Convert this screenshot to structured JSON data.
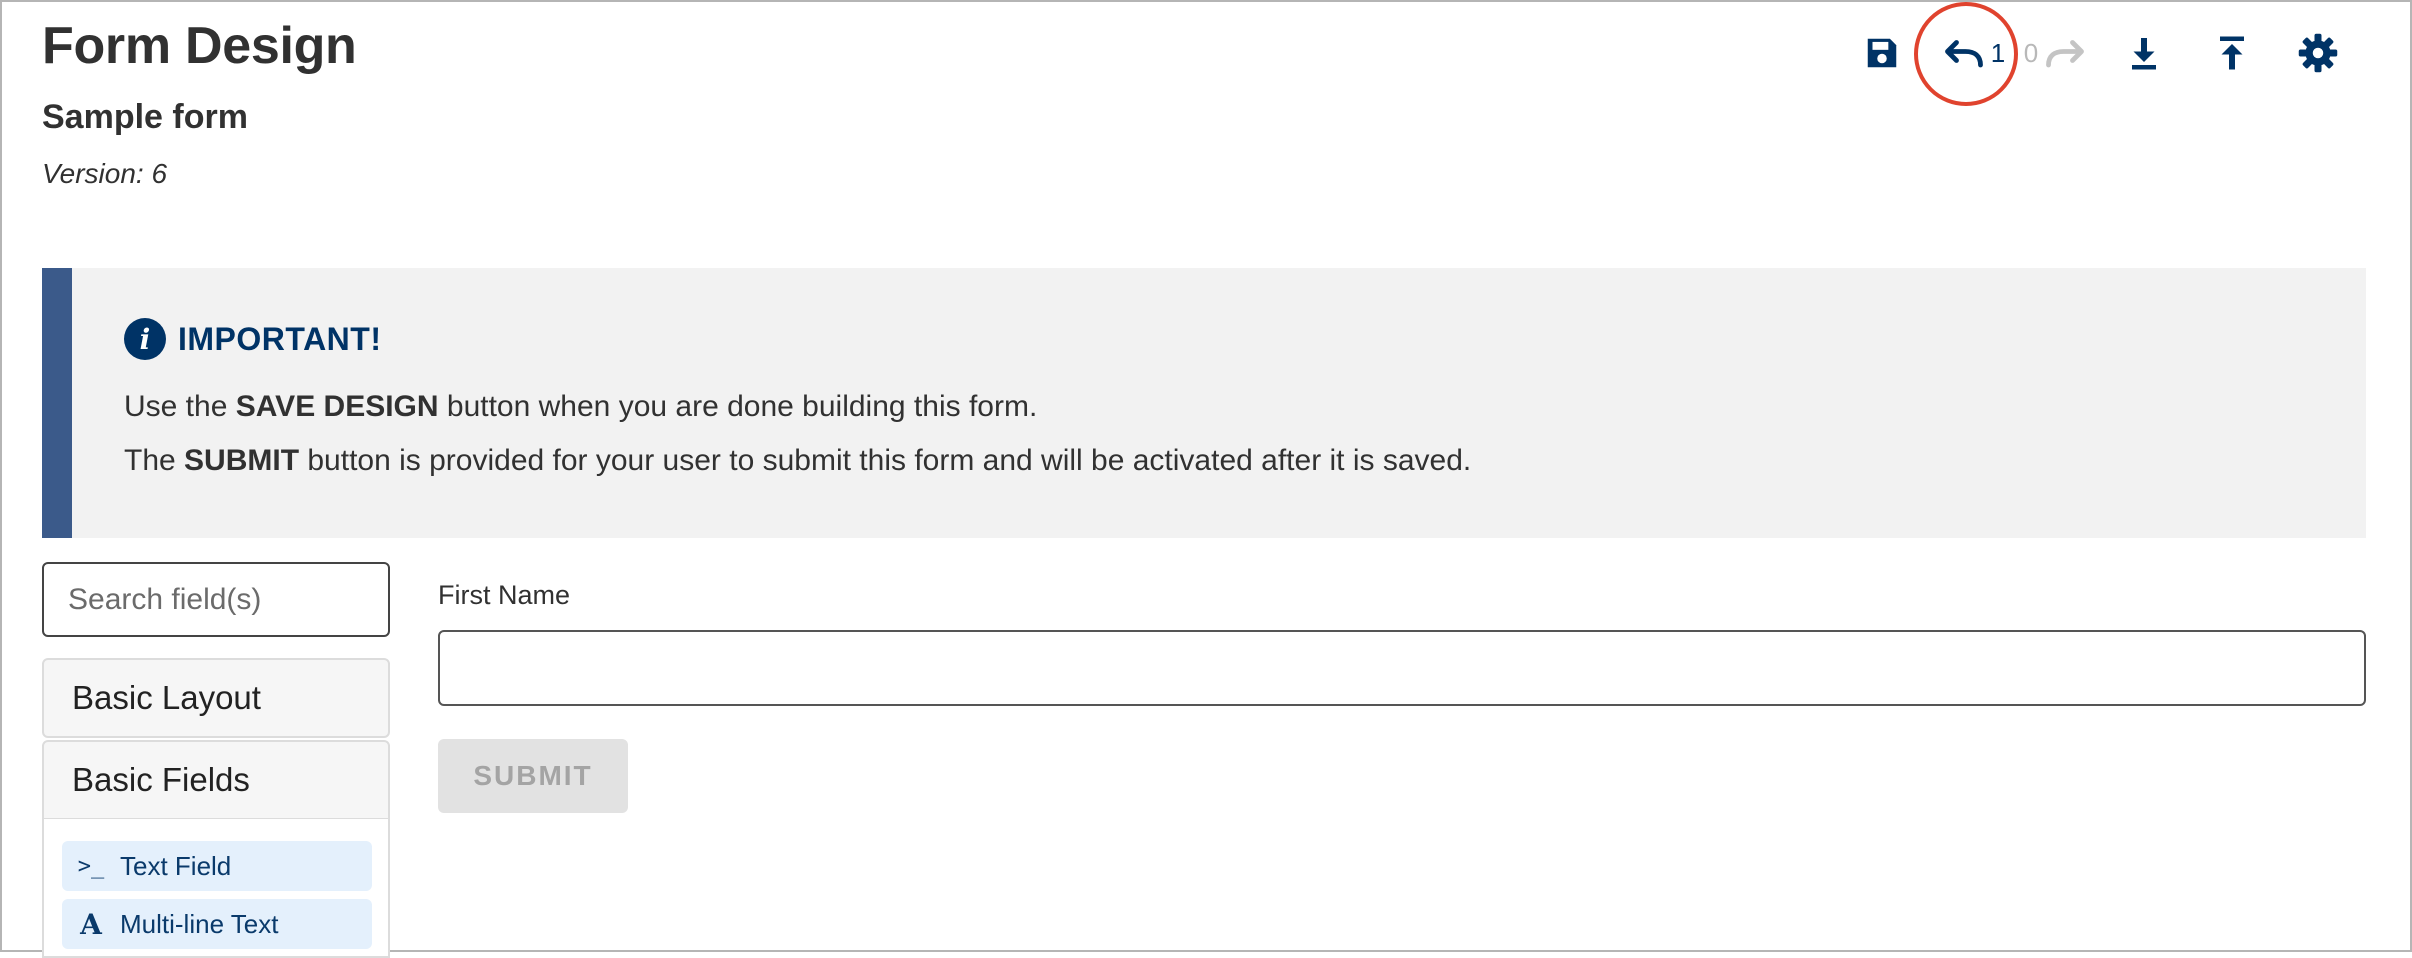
{
  "header": {
    "title": "Form Design",
    "form_name": "Sample form",
    "version": "Version: 6"
  },
  "toolbar": {
    "items": [
      {
        "name": "save",
        "icon": "save-icon"
      },
      {
        "name": "undo",
        "icon": "undo-icon",
        "count": "1"
      },
      {
        "name": "redo",
        "icon": "redo-icon",
        "count": "0"
      },
      {
        "name": "download",
        "icon": "download-icon"
      },
      {
        "name": "upload",
        "icon": "upload-icon"
      },
      {
        "name": "settings",
        "icon": "gear-icon"
      }
    ],
    "highlight_color": "#e0432e",
    "icon_color": "#003366"
  },
  "notice": {
    "icon": "info-icon",
    "title": "IMPORTANT!",
    "line1_pre": "Use the ",
    "line1_bold": "SAVE DESIGN",
    "line1_post": " button when you are done building this form.",
    "line2_pre": "The ",
    "line2_bold": "SUBMIT",
    "line2_post": " button is provided for your user to submit this form and will be activated after it is saved."
  },
  "sidebar": {
    "search_placeholder": "Search field(s)",
    "sections": [
      {
        "label": "Basic Layout"
      },
      {
        "label": "Basic Fields"
      }
    ],
    "fields": [
      {
        "label": "Text Field",
        "icon": "terminal-icon",
        "glyph": ">_"
      },
      {
        "label": "Multi-line Text",
        "icon": "font-icon",
        "glyph": "A"
      }
    ]
  },
  "form": {
    "field_label": "First Name",
    "field_value": "",
    "submit_label": "SUBMIT"
  }
}
